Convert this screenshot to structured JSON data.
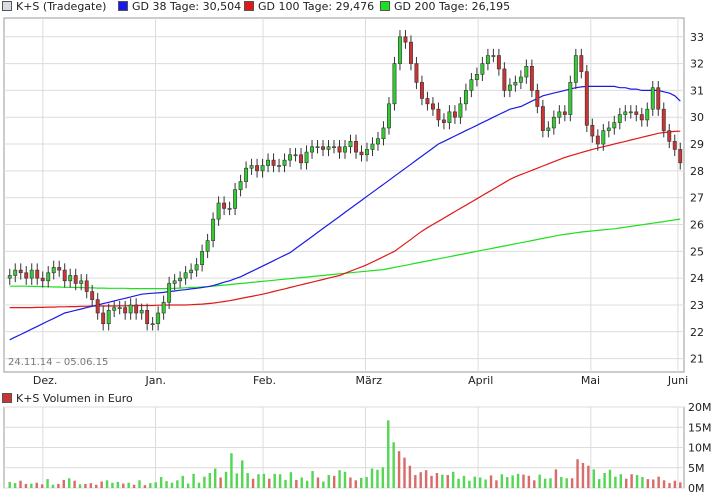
{
  "chart_data": [
    {
      "type": "candlestick",
      "title": "",
      "legend": [
        {
          "label": "K+S (Tradegate)",
          "color": "#d9dde3"
        },
        {
          "label": "GD 38 Tage: 30,504",
          "color": "#1a1ae6"
        },
        {
          "label": "GD 100 Tage: 29,476",
          "color": "#e01818"
        },
        {
          "label": "GD 200 Tage: 26,195",
          "color": "#1ee01e"
        }
      ],
      "date_range_label": "24.11.14 – 05.06.15",
      "x_tick_labels": [
        "Dez.",
        "Jan.",
        "Feb.",
        "März",
        "April",
        "Mai",
        "Juni"
      ],
      "y_tick_labels": [
        "21",
        "22",
        "23",
        "24",
        "25",
        "26",
        "27",
        "28",
        "29",
        "30",
        "31",
        "32",
        "33"
      ],
      "ylim": [
        20.5,
        33.7
      ],
      "grid": true,
      "up_color": "#33cc33",
      "down_color": "#cc3333",
      "close": [
        24.1,
        24.3,
        24.2,
        24.0,
        24.3,
        24.0,
        23.9,
        24.2,
        24.4,
        24.3,
        23.9,
        24.1,
        23.8,
        23.9,
        23.5,
        23.2,
        22.7,
        22.3,
        22.8,
        22.9,
        22.9,
        22.7,
        23.0,
        22.7,
        22.8,
        22.3,
        22.3,
        22.7,
        23.1,
        23.8,
        23.9,
        24.0,
        24.2,
        24.3,
        24.5,
        25.0,
        25.4,
        26.2,
        26.8,
        26.6,
        26.6,
        27.3,
        27.6,
        28.1,
        28.2,
        28.0,
        28.2,
        28.4,
        28.2,
        28.2,
        28.4,
        28.6,
        28.6,
        28.3,
        28.7,
        28.9,
        28.9,
        28.8,
        28.9,
        28.9,
        28.7,
        28.9,
        29.1,
        28.7,
        28.6,
        28.8,
        29.0,
        29.2,
        29.6,
        30.5,
        32.0,
        33.0,
        32.8,
        32.0,
        31.3,
        30.7,
        30.5,
        30.3,
        29.9,
        29.8,
        30.2,
        30.0,
        30.5,
        31.0,
        31.4,
        31.6,
        32.0,
        32.3,
        32.3,
        31.8,
        31.0,
        31.2,
        31.3,
        31.5,
        31.9,
        31.0,
        30.4,
        29.5,
        29.6,
        30.0,
        30.2,
        30.1,
        31.3,
        32.3,
        31.7,
        29.7,
        29.3,
        29.0,
        29.5,
        29.6,
        29.8,
        30.1,
        30.2,
        30.2,
        30.1,
        29.9,
        30.3,
        31.1,
        30.3,
        29.5,
        29.1,
        28.8,
        28.3
      ],
      "volume_panel": {
        "title": "K+S Volumen in Euro",
        "y_tick_labels": [
          "0M",
          "5M",
          "10M",
          "15M",
          "20M"
        ],
        "ylim": [
          0,
          20
        ],
        "volumes": [
          1.5,
          1.2,
          1.8,
          1.0,
          1.1,
          1.3,
          0.9,
          2.2,
          0.8,
          1.0,
          2.0,
          2.4,
          1.8,
          0.9,
          1.0,
          1.2,
          0.8,
          1.6,
          1.9,
          1.3,
          1.5,
          1.1,
          1.3,
          0.8,
          1.9,
          0.7,
          1.2,
          1.4,
          2.7,
          1.7,
          1.3,
          1.9,
          3.0,
          1.1,
          3.5,
          1.3,
          2.8,
          3.7,
          4.8,
          2.6,
          4.0,
          8.6,
          3.6,
          6.8,
          3.7,
          2.3,
          3.4,
          3.5,
          2.3,
          3.5,
          3.4,
          2.0,
          3.9,
          2.0,
          2.6,
          1.8,
          4.2,
          2.6,
          1.6,
          3.2,
          3.0,
          4.4,
          4.0,
          2.6,
          1.9,
          2.5,
          2.7,
          4.8,
          4.5,
          5.1,
          16.7,
          11.3,
          9.1,
          7.5,
          5.5,
          3.2,
          3.9,
          4.4,
          3.0,
          3.7,
          3.3,
          3.2,
          4.0,
          2.3,
          3.0,
          1.8,
          2.8,
          2.6,
          2.1,
          3.1,
          1.9,
          3.4,
          2.7,
          3.1,
          3.5,
          3.3,
          3.0,
          1.9,
          3.3,
          2.3,
          2.4,
          4.6,
          2.7,
          2.4,
          2.4,
          7.1,
          6.2,
          5.5,
          4.6,
          2.2,
          3.7,
          4.5,
          2.8,
          3.4,
          2.3,
          3.4,
          3.2,
          2.7,
          2.2,
          2.1,
          2.8,
          1.9,
          1.2,
          1.8,
          1.4
        ]
      },
      "sma_38": [
        21.7,
        21.8,
        21.9,
        22.0,
        22.1,
        22.2,
        22.3,
        22.4,
        22.5,
        22.6,
        22.7,
        22.75,
        22.8,
        22.85,
        22.9,
        22.95,
        23.0,
        23.05,
        23.1,
        23.15,
        23.2,
        23.25,
        23.3,
        23.35,
        23.4,
        23.42,
        23.44,
        23.45,
        23.47,
        23.5,
        23.52,
        23.55,
        23.57,
        23.6,
        23.62,
        23.65,
        23.68,
        23.72,
        23.78,
        23.85,
        23.9,
        23.98,
        24.05,
        24.15,
        24.25,
        24.35,
        24.45,
        24.55,
        24.65,
        24.75,
        24.85,
        24.95,
        25.1,
        25.25,
        25.4,
        25.55,
        25.7,
        25.85,
        26.0,
        26.15,
        26.3,
        26.45,
        26.6,
        26.75,
        26.9,
        27.05,
        27.2,
        27.35,
        27.5,
        27.65,
        27.8,
        27.95,
        28.1,
        28.25,
        28.4,
        28.55,
        28.7,
        28.85,
        29.0,
        29.1,
        29.2,
        29.3,
        29.4,
        29.5,
        29.6,
        29.7,
        29.8,
        29.9,
        30.0,
        30.1,
        30.2,
        30.3,
        30.35,
        30.4,
        30.5,
        30.6,
        30.7,
        30.8,
        30.85,
        30.9,
        30.95,
        31.0,
        31.05,
        31.1,
        31.13,
        31.15,
        31.15,
        31.15,
        31.15,
        31.15,
        31.15,
        31.1,
        31.1,
        31.05,
        31.05,
        31.0,
        31.0,
        31.0,
        31.0,
        30.95,
        30.9,
        30.8,
        30.6
      ],
      "sma_100": [
        22.9,
        22.9,
        22.9,
        22.9,
        22.9,
        22.91,
        22.91,
        22.92,
        22.92,
        22.93,
        22.93,
        22.94,
        22.94,
        22.95,
        22.95,
        22.96,
        22.96,
        22.96,
        22.96,
        22.96,
        22.97,
        22.97,
        22.97,
        22.98,
        22.98,
        22.98,
        22.98,
        22.99,
        22.99,
        23.0,
        23.0,
        23.0,
        23.0,
        23.01,
        23.02,
        23.03,
        23.05,
        23.07,
        23.1,
        23.13,
        23.16,
        23.2,
        23.24,
        23.28,
        23.32,
        23.36,
        23.4,
        23.45,
        23.5,
        23.55,
        23.6,
        23.65,
        23.7,
        23.75,
        23.8,
        23.85,
        23.9,
        23.95,
        24.0,
        24.05,
        24.1,
        24.18,
        24.26,
        24.34,
        24.42,
        24.5,
        24.6,
        24.7,
        24.8,
        24.9,
        25.0,
        25.15,
        25.3,
        25.45,
        25.6,
        25.75,
        25.88,
        26.0,
        26.12,
        26.24,
        26.36,
        26.48,
        26.6,
        26.72,
        26.84,
        26.96,
        27.08,
        27.2,
        27.32,
        27.44,
        27.56,
        27.68,
        27.78,
        27.86,
        27.94,
        28.02,
        28.1,
        28.18,
        28.26,
        28.34,
        28.42,
        28.5,
        28.56,
        28.62,
        28.68,
        28.74,
        28.8,
        28.85,
        28.9,
        28.95,
        29.0,
        29.05,
        29.1,
        29.15,
        29.2,
        29.25,
        29.3,
        29.35,
        29.4,
        29.43,
        29.45,
        29.47,
        29.48
      ],
      "sma_200": [
        23.7,
        23.7,
        23.7,
        23.7,
        23.69,
        23.69,
        23.68,
        23.68,
        23.67,
        23.67,
        23.66,
        23.66,
        23.65,
        23.65,
        23.64,
        23.64,
        23.63,
        23.63,
        23.62,
        23.62,
        23.62,
        23.62,
        23.61,
        23.61,
        23.61,
        23.61,
        23.61,
        23.61,
        23.61,
        23.61,
        23.62,
        23.63,
        23.64,
        23.65,
        23.66,
        23.67,
        23.68,
        23.7,
        23.72,
        23.74,
        23.76,
        23.78,
        23.8,
        23.82,
        23.84,
        23.86,
        23.88,
        23.9,
        23.92,
        23.94,
        23.96,
        23.98,
        24.0,
        24.02,
        24.04,
        24.06,
        24.08,
        24.1,
        24.12,
        24.14,
        24.16,
        24.18,
        24.2,
        24.22,
        24.24,
        24.26,
        24.28,
        24.3,
        24.32,
        24.36,
        24.4,
        24.44,
        24.48,
        24.52,
        24.56,
        24.6,
        24.64,
        24.68,
        24.72,
        24.76,
        24.8,
        24.84,
        24.88,
        24.92,
        24.96,
        25.0,
        25.04,
        25.08,
        25.12,
        25.16,
        25.2,
        25.24,
        25.28,
        25.32,
        25.36,
        25.4,
        25.44,
        25.48,
        25.52,
        25.56,
        25.6,
        25.63,
        25.66,
        25.69,
        25.72,
        25.74,
        25.76,
        25.78,
        25.8,
        25.82,
        25.84,
        25.87,
        25.9,
        25.93,
        25.96,
        25.99,
        26.02,
        26.05,
        26.08,
        26.11,
        26.14,
        26.17,
        26.2
      ]
    }
  ]
}
